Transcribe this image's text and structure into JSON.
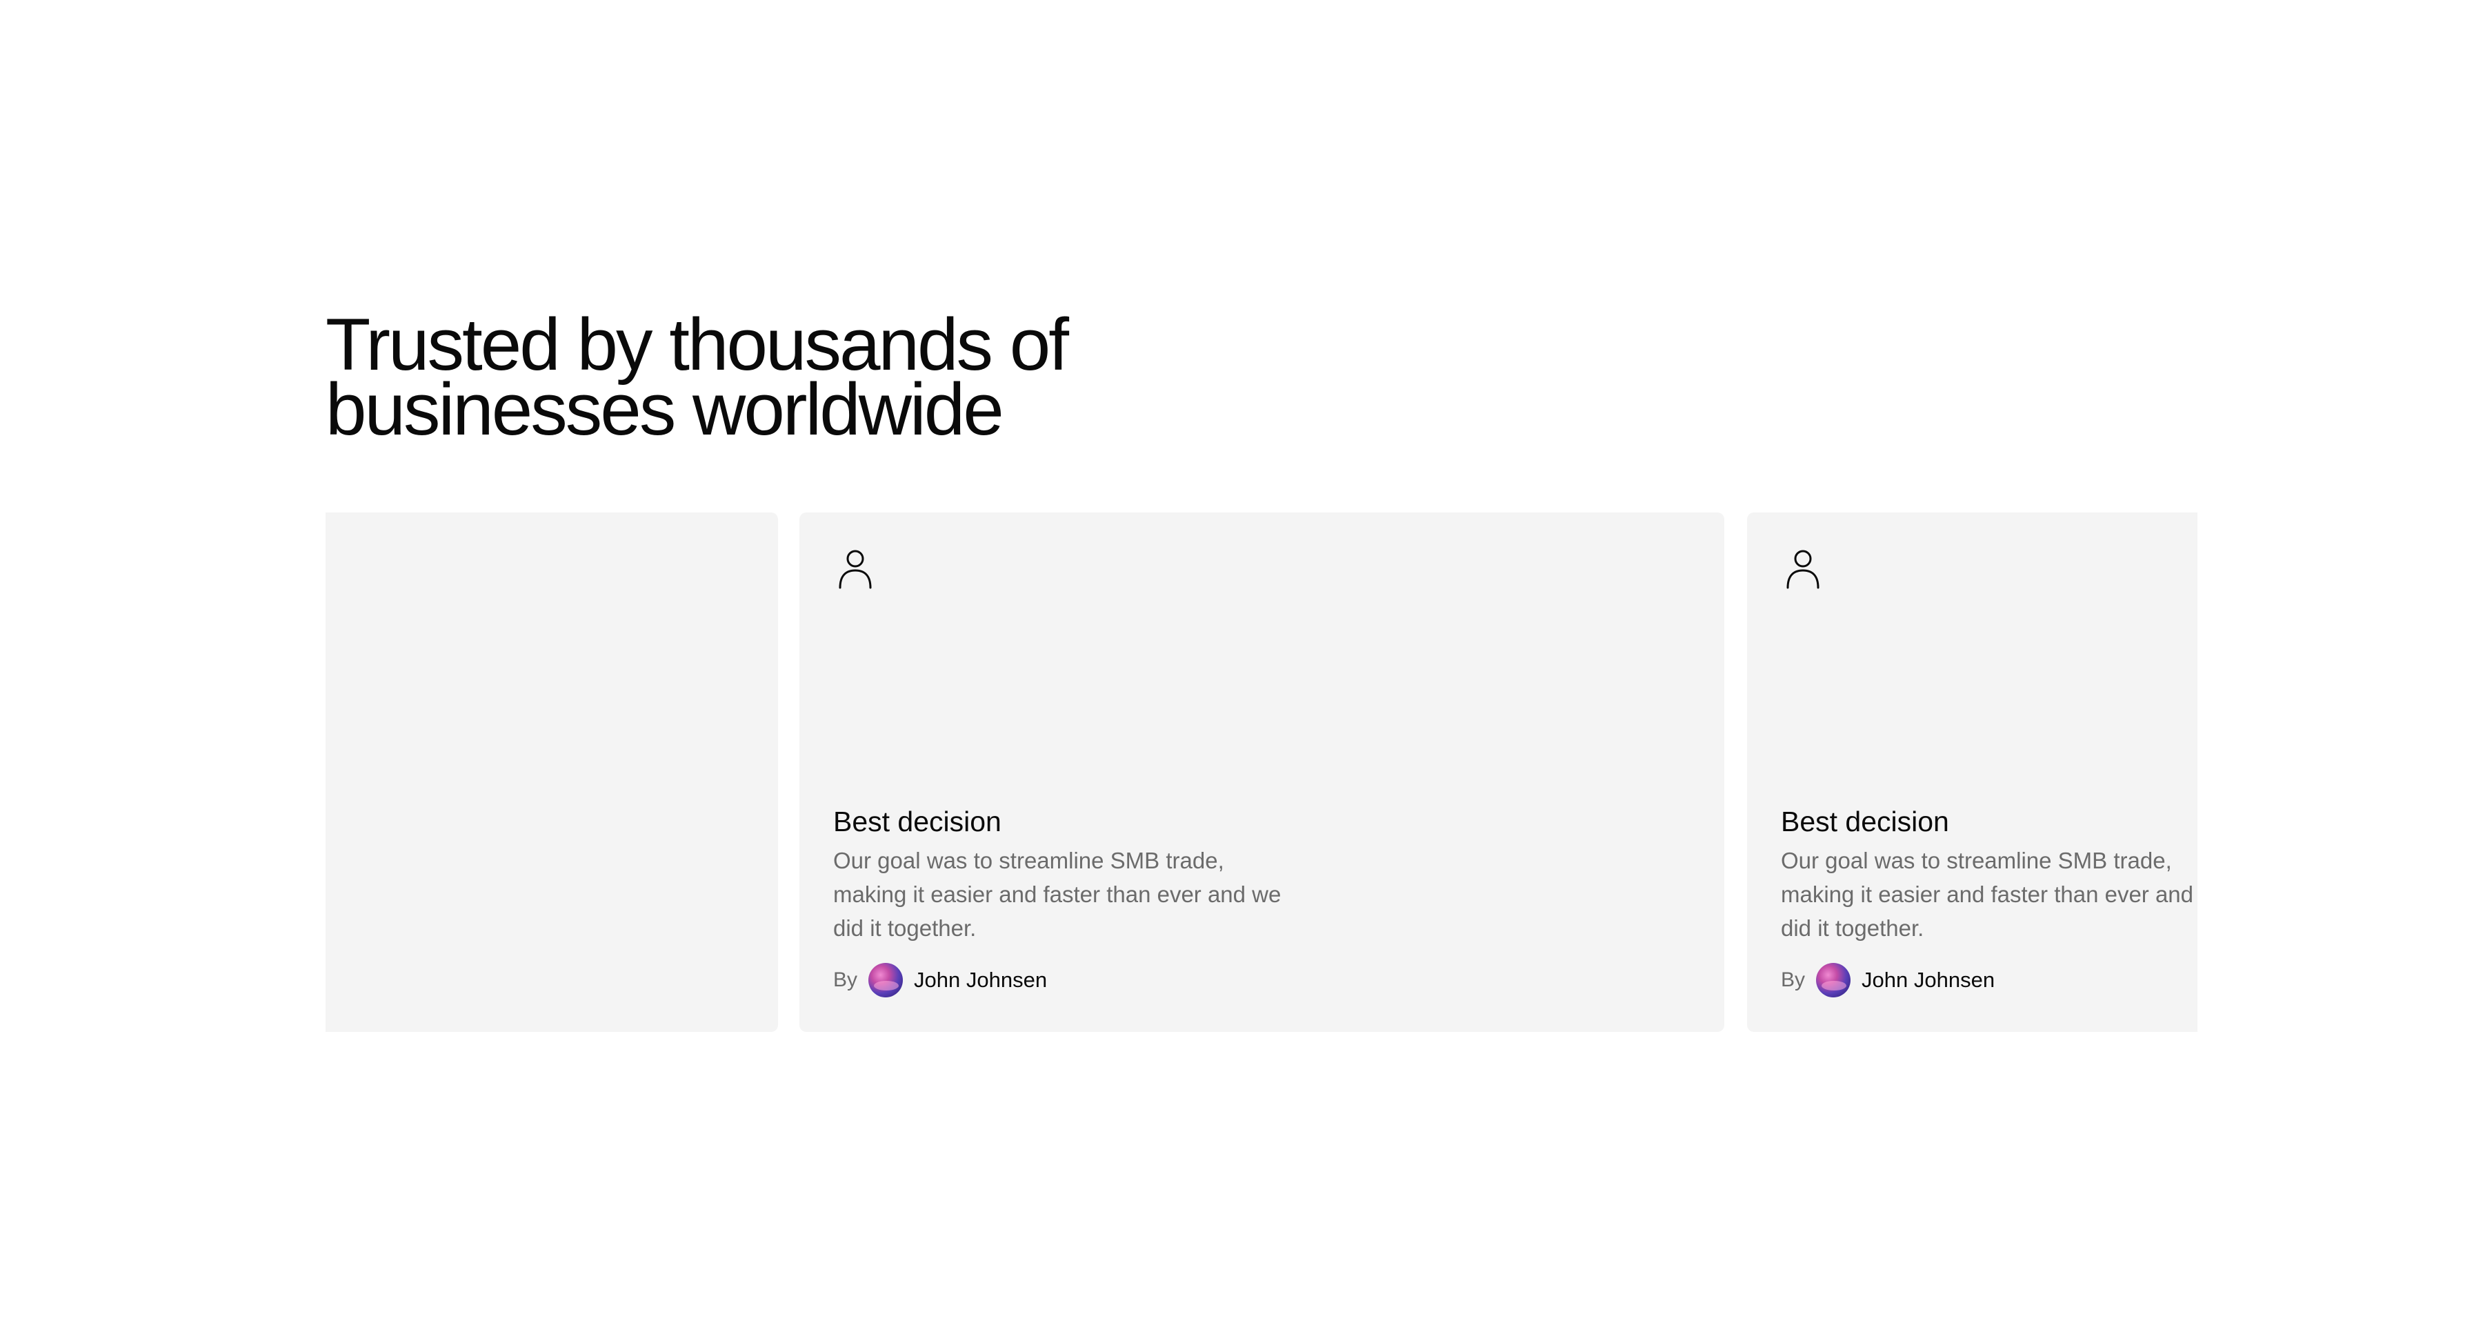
{
  "section": {
    "heading_line1": "Trusted by thousands of",
    "heading_line2": "businesses worldwide"
  },
  "testimonials": [
    {
      "icon": "user-icon",
      "title": "Best decision",
      "text": "Our goal was to streamline SMB trade, making it easier and faster than ever and we did it together.",
      "by_label": "By",
      "author": "John Johnsen"
    },
    {
      "icon": "user-icon",
      "title": "Best decision",
      "text": "Our goal was to streamline SMB trade, making it easier and faster than ever and we did it together.",
      "by_label": "By",
      "author": "John Johnsen"
    }
  ],
  "colors": {
    "card_background": "#f4f4f4",
    "heading": "#0a0a0a",
    "body_text": "#6b6b6b"
  }
}
